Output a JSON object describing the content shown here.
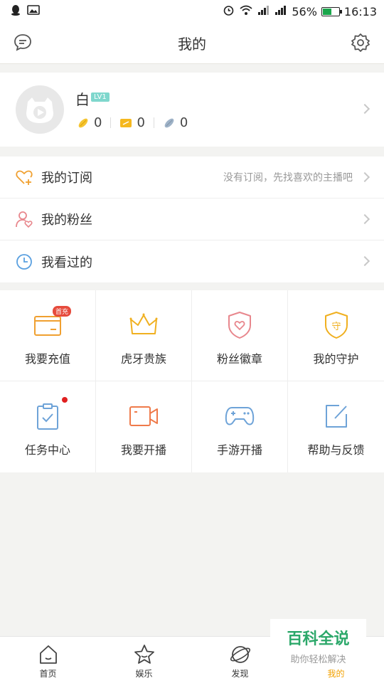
{
  "status_bar": {
    "battery": "56%",
    "time": "16:13",
    "battery_level": 0.56
  },
  "header": {
    "title": "我的",
    "left_icon": "message-icon",
    "right_icon": "gear-icon"
  },
  "profile": {
    "name": "白",
    "level": "LV1",
    "assets": [
      "0",
      "0",
      "0"
    ]
  },
  "menu": [
    {
      "label": "我的订阅",
      "hint": "没有订阅，先找喜欢的主播吧",
      "icon": "heart-plus-icon"
    },
    {
      "label": "我的粉丝",
      "hint": "",
      "icon": "user-heart-icon"
    },
    {
      "label": "我看过的",
      "hint": "",
      "icon": "clock-icon"
    }
  ],
  "grid": [
    {
      "label": "我要充值",
      "badge": "首充",
      "icon": "wallet-icon"
    },
    {
      "label": "虎牙贵族",
      "icon": "crown-icon"
    },
    {
      "label": "粉丝徽章",
      "icon": "shield-heart-icon"
    },
    {
      "label": "我的守护",
      "glyph": "守",
      "icon": "guard-shield-icon"
    },
    {
      "label": "任务中心",
      "icon": "clipboard-icon"
    },
    {
      "label": "我要开播",
      "icon": "video-camera-icon"
    },
    {
      "label": "手游开播",
      "icon": "gamepad-icon"
    },
    {
      "label": "帮助与反馈",
      "icon": "edit-icon"
    }
  ],
  "watermark": {
    "title": "百科全说",
    "subtitle": "助你轻松解决"
  },
  "tabs": [
    {
      "label": "首页",
      "icon": "home-icon"
    },
    {
      "label": "娱乐",
      "icon": "star-icon"
    },
    {
      "label": "发现",
      "icon": "planet-icon"
    },
    {
      "label": "我的",
      "icon": "profile-icon",
      "active": true
    }
  ],
  "colors": {
    "accent": "#f2a100",
    "badge_red": "#e64b3c",
    "list_icon_orange": "#f0a030"
  }
}
